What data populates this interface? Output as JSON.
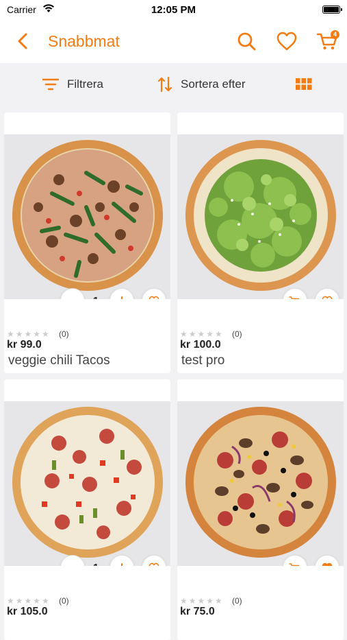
{
  "status": {
    "carrier": "Carrier",
    "time": "12:05 PM"
  },
  "nav": {
    "title": "Snabbmat",
    "cart_count": "4",
    "accent": "#f37c12"
  },
  "filter": {
    "filter_label": "Filtrera",
    "sort_label": "Sortera efter"
  },
  "products": [
    {
      "name": "veggie chili Tacos",
      "price": "kr 99.0",
      "rating_count": "(0)",
      "qty": "1",
      "favorited": false,
      "pizza": "veggie-arugula-pizza"
    },
    {
      "name": "test pro",
      "price": "kr 100.0",
      "rating_count": "(0)",
      "qty": "",
      "favorited": false,
      "pizza": "lettuce-pizza"
    },
    {
      "name": "",
      "price": "kr 105.0",
      "rating_count": "(0)",
      "qty": "1",
      "favorited": false,
      "pizza": "salami-pepper-pizza"
    },
    {
      "name": "",
      "price": "kr 75.0",
      "rating_count": "(0)",
      "qty": "",
      "favorited": true,
      "pizza": "mushroom-salami-pizza"
    }
  ]
}
